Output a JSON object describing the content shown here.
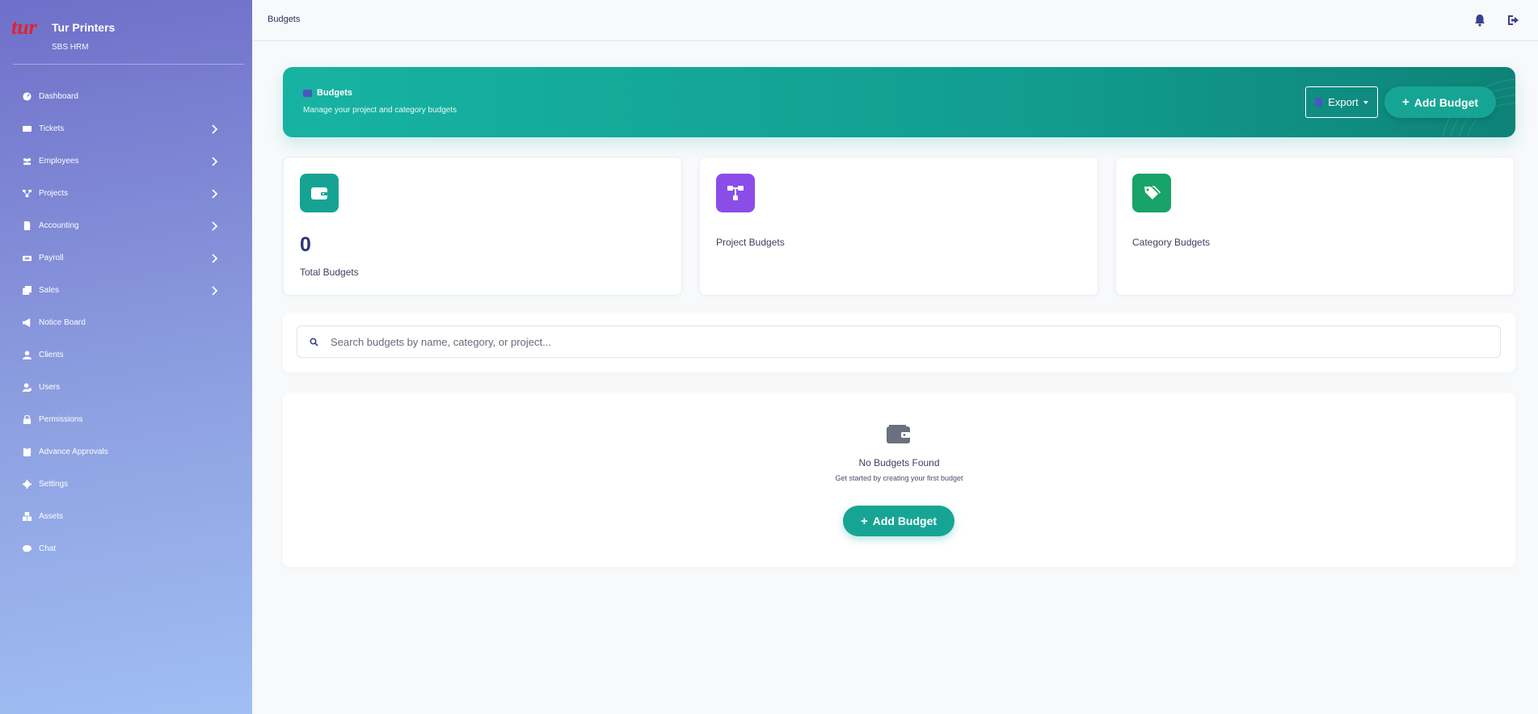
{
  "brand": {
    "name": "Tur Printers",
    "subtitle": "SBS HRM",
    "logo_text": "tur"
  },
  "sidebar": {
    "items": [
      {
        "label": "Dashboard",
        "icon": "dashboard-icon",
        "has_submenu": false
      },
      {
        "label": "Tickets",
        "icon": "ticket-icon",
        "has_submenu": true
      },
      {
        "label": "Employees",
        "icon": "users-group-icon",
        "has_submenu": true
      },
      {
        "label": "Projects",
        "icon": "project-tree-icon",
        "has_submenu": true
      },
      {
        "label": "Accounting",
        "icon": "file-invoice-icon",
        "has_submenu": true
      },
      {
        "label": "Payroll",
        "icon": "money-bill-icon",
        "has_submenu": true
      },
      {
        "label": "Sales",
        "icon": "copy-icon",
        "has_submenu": true
      },
      {
        "label": "Notice Board",
        "icon": "megaphone-icon",
        "has_submenu": false
      },
      {
        "label": "Clients",
        "icon": "user-icon",
        "has_submenu": false
      },
      {
        "label": "Users",
        "icon": "user-gear-icon",
        "has_submenu": false
      },
      {
        "label": "Permissions",
        "icon": "lock-icon",
        "has_submenu": false
      },
      {
        "label": "Advance Approvals",
        "icon": "clipboard-icon",
        "has_submenu": false
      },
      {
        "label": "Settings",
        "icon": "gear-icon",
        "has_submenu": false
      },
      {
        "label": "Assets",
        "icon": "cubes-icon",
        "has_submenu": false
      },
      {
        "label": "Chat",
        "icon": "chat-icon",
        "has_submenu": false
      }
    ]
  },
  "topbar": {
    "crumb": "Budgets",
    "icons": [
      "bell-icon",
      "logout-icon"
    ]
  },
  "header": {
    "title": "Budgets",
    "subtitle": "Manage your project and category budgets",
    "export_label": "Export",
    "add_label": "Add Budget",
    "accent": "#17b3a2"
  },
  "stats": [
    {
      "label": "Total Budgets",
      "value": "0",
      "icon": "wallet-icon",
      "color": "#17a394"
    },
    {
      "label": "Project Budgets",
      "value": "",
      "icon": "project-diagram-icon",
      "color": "#8b4de8"
    },
    {
      "label": "Category Budgets",
      "value": "",
      "icon": "tags-icon",
      "color": "#17a36a"
    }
  ],
  "search": {
    "placeholder": "Search budgets by name, category, or project..."
  },
  "empty": {
    "title": "No Budgets Found",
    "subtitle": "Get started by creating your first budget",
    "add_label": "Add Budget"
  }
}
